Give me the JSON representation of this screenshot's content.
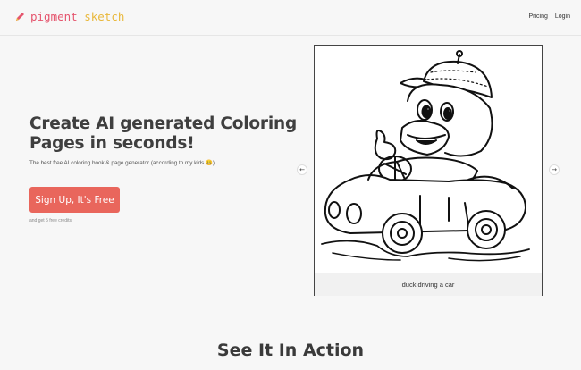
{
  "brand": {
    "word1": "pigment",
    "word2": "sketch",
    "icon": "pencil-icon",
    "colors": {
      "pink": "#e5556e",
      "yellow": "#e9b83b"
    }
  },
  "nav": {
    "pricing": "Pricing",
    "login": "Login"
  },
  "hero": {
    "title": "Create AI generated Coloring Pages in seconds!",
    "subtitle": "The best free AI coloring book & page generator (according to my kids 😀)",
    "cta_label": "Sign Up, It's Free",
    "cta_note": "and get 5 free credits",
    "cta_color": "#e9665c"
  },
  "carousel": {
    "prev_icon": "arrow-left-icon",
    "next_icon": "arrow-right-icon",
    "caption": "duck driving a car"
  },
  "section": {
    "title": "See It In Action"
  }
}
